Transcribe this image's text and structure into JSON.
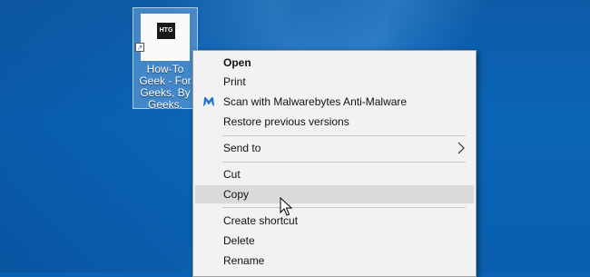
{
  "desktop": {
    "icon": {
      "thumbnail_text": "HTG",
      "label": "How-To Geek - For Geeks, By Geeks."
    }
  },
  "context_menu": {
    "items": [
      {
        "label": "Open",
        "bold": true
      },
      {
        "label": "Print"
      },
      {
        "label": "Scan with Malwarebytes Anti-Malware",
        "icon": "malwarebytes-icon"
      },
      {
        "label": "Restore previous versions"
      },
      {
        "label": "Send to",
        "submenu": true
      },
      {
        "label": "Cut"
      },
      {
        "label": "Copy",
        "highlighted": true
      },
      {
        "label": "Create shortcut"
      },
      {
        "label": "Delete"
      },
      {
        "label": "Rename"
      }
    ]
  },
  "colors": {
    "menu_bg": "#f2f2f2",
    "highlight": "#dadada",
    "desktop_blue": "#0a64b6",
    "malwarebytes_blue": "#1d72d8"
  }
}
